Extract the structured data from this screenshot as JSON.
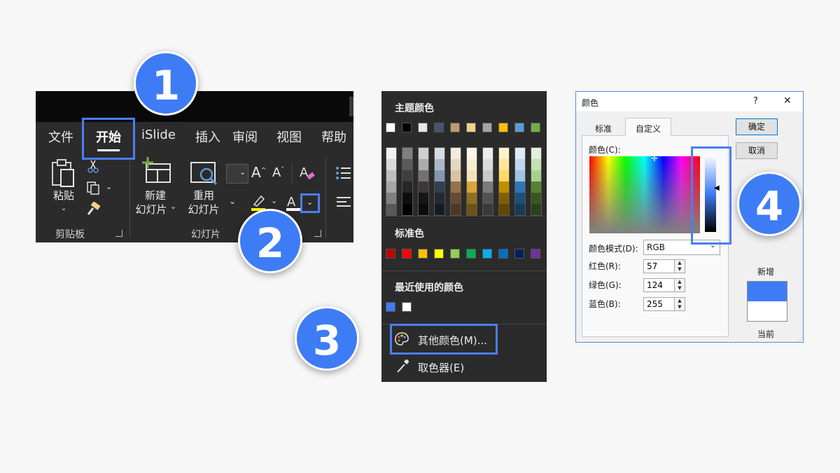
{
  "steps": [
    "1",
    "2",
    "3",
    "4"
  ],
  "ribbon": {
    "tabs": [
      "文件",
      "开始",
      "iSlide",
      "插入",
      "审阅",
      "视图",
      "帮助"
    ],
    "active_tab": "开始",
    "paste_label": "粘贴",
    "new_slide_label": "新建",
    "new_slide_label2": "幻灯片",
    "reuse_slide_label": "重用",
    "reuse_slide_label2": "幻灯片",
    "clipboard_group": "剪贴板",
    "slides_group": "幻灯片",
    "font_color_hex": "#ffffff",
    "highlight_color_hex": "#ffff00"
  },
  "color_menu": {
    "theme_title": "主题颜色",
    "standard_title": "标准色",
    "recent_title": "最近使用的颜色",
    "more_colors_label": "其他颜色(M)...",
    "eyedropper_label": "取色器(E)",
    "theme_colors": [
      "#ffffff",
      "#000000",
      "#e7e6e6",
      "#44546a",
      "#c09a6b",
      "#f1d08b",
      "#a5a5a5",
      "#ffc000",
      "#5b9bd5",
      "#70ad47"
    ],
    "theme_shades": [
      [
        "#f2f2f2",
        "#d9d9d9",
        "#bfbfbf",
        "#a6a6a6",
        "#808080",
        "#595959"
      ],
      [
        "#7f7f7f",
        "#595959",
        "#404040",
        "#262626",
        "#0d0d0d",
        "#000000"
      ],
      [
        "#d0cece",
        "#aeabab",
        "#767171",
        "#3b3838",
        "#171616",
        "#0d0d0d"
      ],
      [
        "#d6dce5",
        "#adb9ca",
        "#8497b0",
        "#333f50",
        "#222a35",
        "#161c24"
      ],
      [
        "#f2ebe1",
        "#e6d7c4",
        "#d9c3a6",
        "#97714a",
        "#654b31",
        "#4c3825"
      ],
      [
        "#fcf5e8",
        "#f9ecd1",
        "#f6e2b9",
        "#d8a637",
        "#916e21",
        "#6d5219"
      ],
      [
        "#ededed",
        "#dbdbdb",
        "#c9c9c9",
        "#7b7b7b",
        "#525252",
        "#3a3a3a"
      ],
      [
        "#fff2cc",
        "#ffe699",
        "#ffd966",
        "#bf9000",
        "#806000",
        "#604800"
      ],
      [
        "#deebf7",
        "#bdd7ee",
        "#9dc3e6",
        "#2e75b6",
        "#1f4e79",
        "#173b5a"
      ],
      [
        "#e2f0d9",
        "#c5e0b4",
        "#a9d18e",
        "#548235",
        "#385723",
        "#2a4119"
      ]
    ],
    "standard_colors": [
      "#c00000",
      "#ff0000",
      "#ffc000",
      "#ffff00",
      "#92d050",
      "#00b050",
      "#00b0f0",
      "#0070c0",
      "#002060",
      "#7030a0"
    ],
    "recent_colors": [
      "#3e7cf5",
      "#ffffff"
    ]
  },
  "dialog": {
    "title": "颜色",
    "help": "?",
    "close": "✕",
    "tab_standard": "标准",
    "tab_custom": "自定义",
    "ok_label": "确定",
    "cancel_label": "取消",
    "colors_label": "颜色(C):",
    "mode_label": "颜色模式(D):",
    "mode_value": "RGB",
    "red_label": "红色(R):",
    "green_label": "绿色(G):",
    "blue_label": "蓝色(B):",
    "red_value": "57",
    "green_value": "124",
    "blue_value": "255",
    "new_label": "新增",
    "current_label": "当前",
    "new_color": "#3e7cf5",
    "current_color": "#ffffff"
  }
}
